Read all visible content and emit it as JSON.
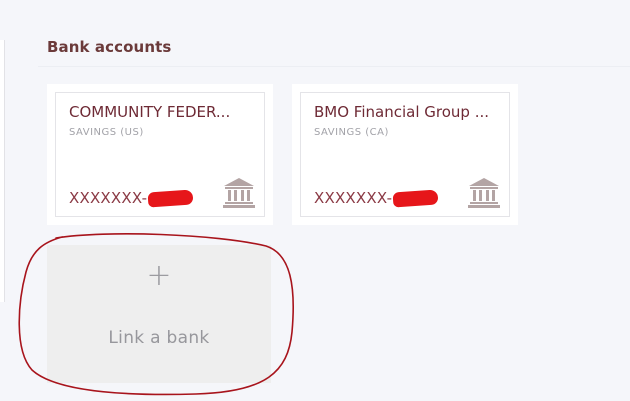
{
  "section": {
    "title": "Bank accounts"
  },
  "accounts": [
    {
      "name": "COMMUNITY FEDER...",
      "type": "SAVINGS (US)",
      "number": "XXXXXXX-",
      "icon": "bank-building-icon"
    },
    {
      "name": "BMO Financial Group ...",
      "type": "SAVINGS (CA)",
      "number": "XXXXXXX-",
      "icon": "bank-building-icon"
    }
  ],
  "link_bank": {
    "plus": "+",
    "label": "Link a bank",
    "icon": "plus-icon"
  },
  "colors": {
    "accent": "#6e2a35",
    "title": "#6b3a3a",
    "redaction": "#e6161a",
    "annotation": "#a8141c",
    "muted": "#a2a2a8"
  }
}
